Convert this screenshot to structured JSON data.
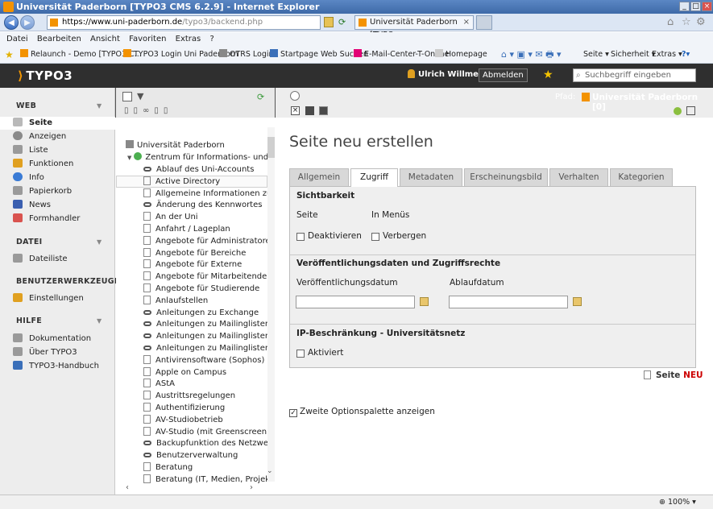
{
  "window": {
    "title": "Universität Paderborn [TYPO3 CMS 6.2.9] - Internet Explorer"
  },
  "browser": {
    "url_host": "https://www.uni-paderborn.de",
    "url_path": "/typo3/backend.php",
    "tab_title": "Universität Paderborn [TYPO...",
    "menu": [
      "Datei",
      "Bearbeiten",
      "Ansicht",
      "Favoriten",
      "Extras",
      "?"
    ],
    "favorites": [
      "Relaunch - Demo [TYPO3 C...",
      "TYPO3 Login Uni Paderborn",
      "OTRS  Login",
      "Startpage Web Suchen",
      "E-Mail-Center-T-Online",
      "Homepage"
    ],
    "toolbar_right": [
      "Seite ▾",
      "Sicherheit ▾",
      "Extras ▾"
    ],
    "zoom": "100%"
  },
  "typo3": {
    "logo": "TYPO3",
    "username": "Ulrich Willmes",
    "logout": "Abmelden",
    "search_placeholder": "Suchbegriff eingeben",
    "path_label": "Pfad:",
    "path_value": "Universität Paderborn [0]"
  },
  "modules": {
    "web_label": "WEB",
    "web_items": [
      "Seite",
      "Anzeigen",
      "Liste",
      "Funktionen",
      "Info",
      "Papierkorb",
      "News",
      "Formhandler"
    ],
    "datei_label": "DATEI",
    "datei_items": [
      "Dateiliste"
    ],
    "tools_label": "BENUTZERWERKZEUGE",
    "tools_items": [
      "Einstellungen"
    ],
    "hilfe_label": "HILFE",
    "hilfe_items": [
      "Dokumentation",
      "Über TYPO3",
      "TYPO3-Handbuch"
    ],
    "icon_colors": [
      "#b9b9b9",
      "#8a8a8a",
      "#9a9a9a",
      "#e0a020",
      "#3a7bd5",
      "#9a9a9a",
      "#3a5fb0",
      "#d9534f"
    ]
  },
  "tree": {
    "root": "Universität Paderborn",
    "zim": "Zentrum für Informations- und M",
    "pages": [
      "Ablauf des Uni-Accounts",
      "Active Directory",
      "Allgemeine Informationen zum",
      "Änderung des Kennwortes",
      "An der Uni",
      "Anfahrt / Lageplan",
      "Angebote für Administratoren",
      "Angebote für Bereiche",
      "Angebote für Externe",
      "Angebote für Mitarbeitende",
      "Angebote für Studierende",
      "Anlaufstellen",
      "Anleitungen zu Exchange",
      "Anleitungen zu Mailinglisten",
      "Anleitungen zu Mailinglisten fü",
      "Anleitungen zu Mailinglisten fü",
      "Antivirensoftware (Sophos)",
      "Apple on Campus",
      "AStA",
      "Austrittsregelungen",
      "Authentifizierung",
      "AV-Studiobetrieb",
      "AV-Studio (mit Greenscreen)",
      "Backupfunktion des Netzwerks",
      "Benutzerverwaltung",
      "Beratung",
      "Beratung (IT, Medien, Projekte"
    ],
    "link_pages": [
      0,
      3,
      12,
      13,
      14,
      15,
      23,
      24
    ]
  },
  "content": {
    "heading": "Seite neu erstellen",
    "tabs": [
      "Allgemein",
      "Zugriff",
      "Metadaten",
      "Erscheinungsbild",
      "Verhalten",
      "Kategorien"
    ],
    "active_tab": "Zugriff",
    "sichtbarkeit": "Sichtbarkeit",
    "col_seite": "Seite",
    "col_menus": "In Menüs",
    "deaktivieren": "Deaktivieren",
    "verbergen": "Verbergen",
    "pub_head": "Veröffentlichungsdaten und Zugriffsrechte",
    "pub_date": "Veröffentlichungsdatum",
    "exp_date": "Ablaufdatum",
    "ip_head": "IP-Beschränkung - Universitätsnetz",
    "aktiviert": "Aktiviert",
    "seite": "Seite",
    "neu": "NEU",
    "second_palette": "Zweite Optionspalette anzeigen"
  }
}
